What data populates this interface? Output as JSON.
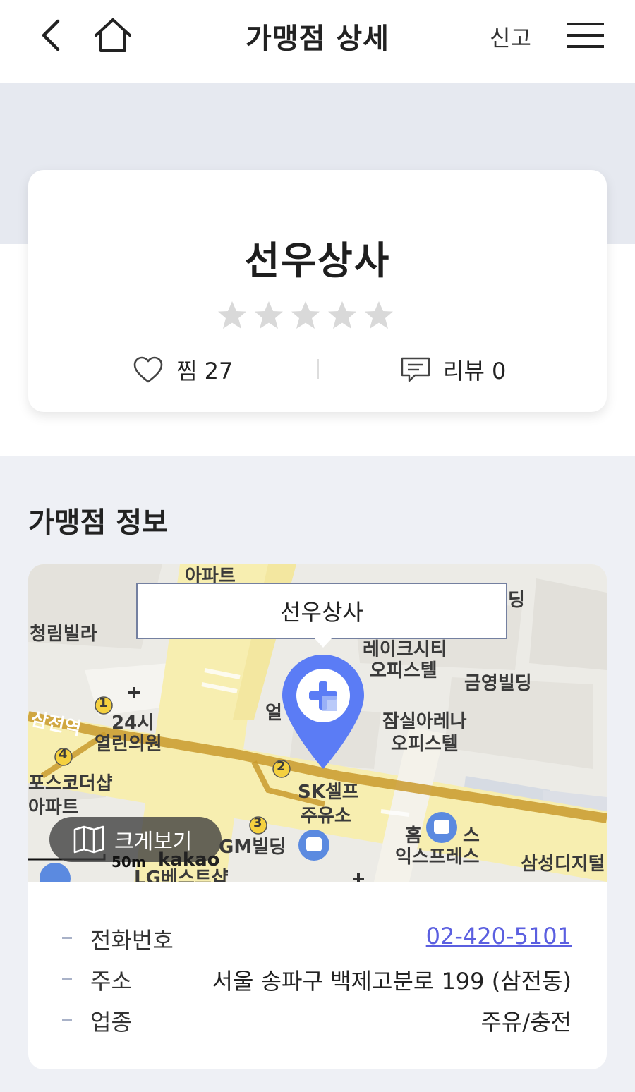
{
  "header": {
    "title": "가맹점 상세",
    "report_label": "신고"
  },
  "store": {
    "name": "선우상사",
    "rating": 0,
    "favorite_label": "찜 27",
    "review_label": "리뷰 0"
  },
  "section": {
    "title": "가맹점 정보"
  },
  "map": {
    "callout": "선우상사",
    "enlarge_label": "크게보기",
    "scale": "50m",
    "provider": "kakao",
    "labels": [
      "아파트",
      "청림빌라",
      "레이크시티",
      "오피스텔",
      "금영빌딩",
      "삼전역",
      "24시",
      "열린의원",
      "얼",
      "잠실아레나",
      "오피스텔",
      "포스코더샵",
      "아파트",
      "SK셀프",
      "주유소",
      "GM빌딩",
      "홈",
      "스",
      "익스프레스",
      "삼성디지털",
      "LG베스트샵",
      "딩"
    ],
    "station_numbers": [
      "1",
      "2",
      "3",
      "4"
    ]
  },
  "info": {
    "rows": [
      {
        "label": "전화번호",
        "value": "02-420-5101",
        "is_link": true
      },
      {
        "label": "주소",
        "value": "서울 송파구 백제고분로 199 (삼전동)",
        "is_link": false
      },
      {
        "label": "업종",
        "value": "주유/충전",
        "is_link": false
      }
    ]
  },
  "colors": {
    "accent": "#5b5fe0",
    "pin": "#5b7cf5",
    "star_empty": "#d9d9d9",
    "road": "#f7eeb0",
    "subway": "#c99a2e"
  }
}
